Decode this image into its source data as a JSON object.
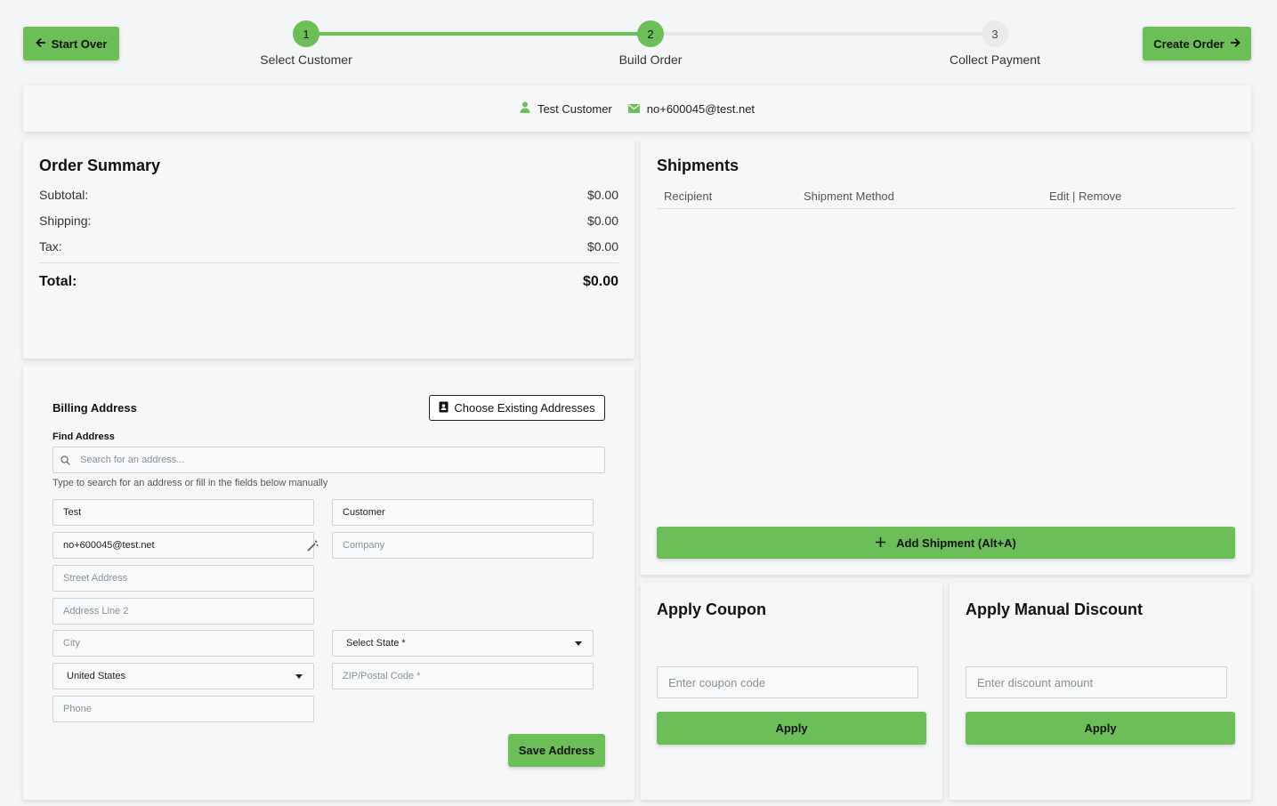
{
  "nav": {
    "start_over": "Start Over",
    "create_order": "Create Order"
  },
  "stepper": {
    "steps": [
      {
        "number": "1",
        "label": "Select Customer"
      },
      {
        "number": "2",
        "label": "Build Order"
      },
      {
        "number": "3",
        "label": "Collect Payment"
      }
    ],
    "current_step": 2
  },
  "customer": {
    "name": "Test Customer",
    "email": "no+600045@test.net"
  },
  "order_summary": {
    "title": "Order Summary",
    "rows": [
      {
        "label": "Subtotal:",
        "value": "$0.00"
      },
      {
        "label": "Shipping:",
        "value": "$0.00"
      },
      {
        "label": "Tax:",
        "value": "$0.00"
      }
    ],
    "total_label": "Total:",
    "total_value": "$0.00"
  },
  "shipments": {
    "title": "Shipments",
    "columns": [
      "Recipient",
      "Shipment Method",
      "Edit | Remove"
    ],
    "add_button": "Add Shipment (Alt+A)"
  },
  "billing": {
    "title": "Billing Address",
    "choose_existing": "Choose Existing Addresses",
    "find_label": "Find Address",
    "search_placeholder": "Search for an address...",
    "search_help": "Type to search for an address or fill in the fields below manually",
    "first_name": "Test",
    "last_name": "Customer",
    "email": "no+600045@test.net",
    "company_placeholder": "Company",
    "street_placeholder": "Street Address",
    "line2_placeholder": "Address Line 2",
    "city_placeholder": "City",
    "state_placeholder": "Select State *",
    "country": "United States",
    "zip_placeholder": "ZIP/Postal Code *",
    "phone_placeholder": "Phone",
    "save_button": "Save Address"
  },
  "coupon": {
    "title": "Apply Coupon",
    "placeholder": "Enter coupon code",
    "apply": "Apply"
  },
  "discount": {
    "title": "Apply Manual Discount",
    "placeholder": "Enter discount amount",
    "apply": "Apply"
  },
  "colors": {
    "accent": "#6cbf58",
    "step_inactive": "#e6e7e8"
  }
}
